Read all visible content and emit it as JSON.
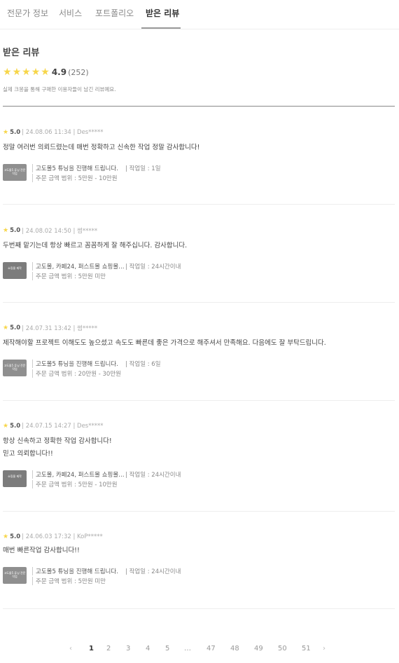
{
  "tabs": [
    {
      "label": "전문가 정보"
    },
    {
      "label": "서비스"
    },
    {
      "label": "포트폴리오"
    },
    {
      "label": "받은 리뷰"
    }
  ],
  "reviews_section": {
    "title": "받은 리뷰",
    "rating": "4.9",
    "count": "(252)",
    "subtitle": "실제 크몽을 통해 구매한 이용자들이 남긴 리뷰예요.",
    "star_color": "#f7d64a"
  },
  "reviews": [
    {
      "score": "5.0",
      "meta": "| 24.08.06 11:34 | Des*****",
      "lines": [
        "정말 여러번 의뢰드렸는데 매번 정확하고 신속한 작업 정말 감사합니다!"
      ],
      "product": "고도몰5 튜닝을 진행해 드립니다.",
      "days": "| 작업일 : 1일",
      "price": "주문 금액 범위 : 5만원 - 10만원",
      "thumb": "고도몰5 튜닝 전문 작업"
    },
    {
      "score": "5.0",
      "meta": "| 24.08.02 14:50 | 썸*****",
      "lines": [
        "두번째 맡기는데 항상 빠르고 꼼꼼하게 잘 해주십니다. 감사합니다."
      ],
      "product": "고도몰, 카페24, 퍼스트몰 쇼핑몰…",
      "days": "| 작업일 : 24시간이내",
      "price": "주문 금액 범위 : 5만원 미만",
      "thumb": "쇼핑몰 제작"
    },
    {
      "score": "5.0",
      "meta": "| 24.07.31 13:42 | 썸*****",
      "lines": [
        "제작해야할 프로젝트 이해도도 높으셨고 속도도 빠른데 좋은 가격으로 해주셔서 만족해요. 다음에도 잘 부탁드립니다."
      ],
      "product": "고도몰5 튜닝을 진행해 드립니다.",
      "days": "| 작업일 : 6일",
      "price": "주문 금액 범위 : 20만원 - 30만원",
      "thumb": "고도몰5 튜닝 전문 작업"
    },
    {
      "score": "5.0",
      "meta": "| 24.07.15 14:27 | Des*****",
      "lines": [
        "항상 신속하고 정확한 작업 감사합니다!",
        "믿고 의뢰합니다!!"
      ],
      "product": "고도몰, 카페24, 퍼스트몰 쇼핑몰…",
      "days": "| 작업일 : 24시간이내",
      "price": "주문 금액 범위 : 5만원 - 10만원",
      "thumb": "쇼핑몰 제작"
    },
    {
      "score": "5.0",
      "meta": "| 24.06.03 17:32 | KoP*****",
      "lines": [
        "매번 빠른작업 감사합니다!!"
      ],
      "product": "고도몰5 튜닝을 진행해 드립니다.",
      "days": "| 작업일 : 24시간이내",
      "price": "주문 금액 범위 : 5만원 미만",
      "thumb": "고도몰5 튜닝 전문 작업"
    }
  ],
  "pagination": {
    "prev_icon": "chevron-left-icon",
    "next_icon": "chevron-right-icon",
    "pages": [
      "1",
      "2",
      "3",
      "4",
      "5",
      "…",
      "47",
      "48",
      "49",
      "50",
      "51"
    ],
    "current": "1"
  }
}
